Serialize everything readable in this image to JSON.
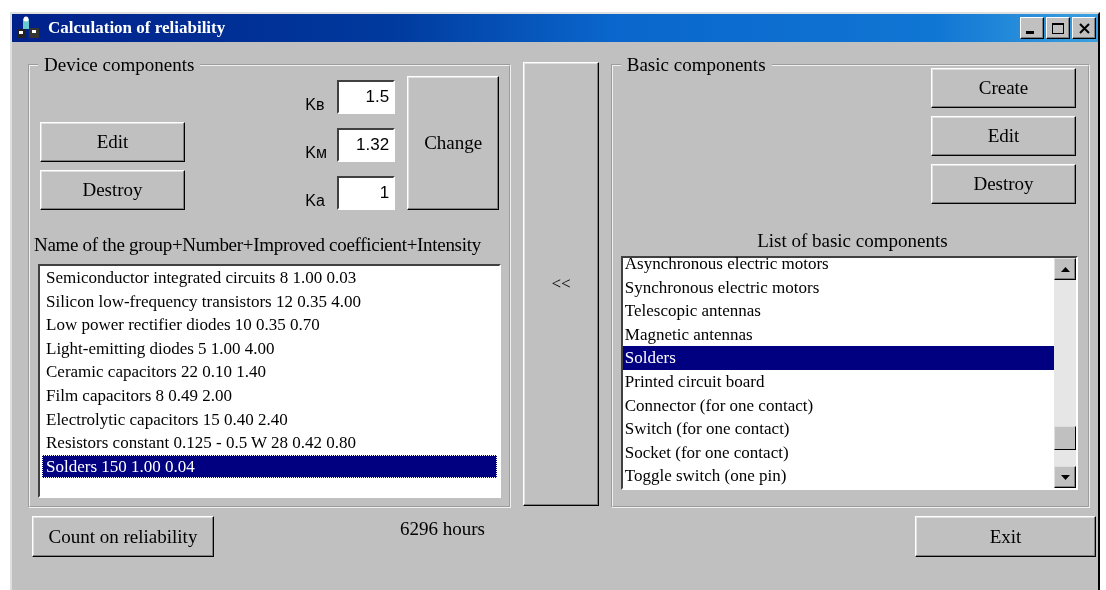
{
  "window": {
    "title": "Calculation of reliability"
  },
  "device_components": {
    "legend": "Device components",
    "buttons": [
      "Edit",
      "Destroy"
    ],
    "coefficients": [
      {
        "label": "Kв",
        "value": "1.5"
      },
      {
        "label": "Kм",
        "value": "1.32"
      },
      {
        "label": "Ka",
        "value": "1"
      }
    ],
    "change_button": "Change",
    "list_caption": "Name of the group+Number+Improved coefficient+Intensity",
    "items": [
      {
        "text": "Semiconductor integrated circuits 8 1.00 0.03",
        "selected": false
      },
      {
        "text": "Silicon low-frequency transistors 12 0.35 4.00",
        "selected": false
      },
      {
        "text": "Low power rectifier diodes 10 0.35 0.70",
        "selected": false
      },
      {
        "text": "Light-emitting diodes 5 1.00 4.00",
        "selected": false
      },
      {
        "text": "Ceramic capacitors 22 0.10 1.40",
        "selected": false
      },
      {
        "text": "Film capacitors 8 0.49 2.00",
        "selected": false
      },
      {
        "text": "Electrolytic capacitors 15 0.40 2.40",
        "selected": false
      },
      {
        "text": "Resistors constant 0.125 - 0.5 W 28 0.42 0.80",
        "selected": false
      },
      {
        "text": "Solders 150 1.00 0.04",
        "selected": true
      }
    ]
  },
  "transfer_button": "<<",
  "basic_components": {
    "legend": "Basic components",
    "buttons": [
      "Create",
      "Edit",
      "Destroy"
    ],
    "list_caption": "List of basic components",
    "items": [
      {
        "text": "Asynchronous electric motors",
        "selected": false
      },
      {
        "text": "Synchronous electric motors",
        "selected": false
      },
      {
        "text": "Telescopic antennas",
        "selected": false
      },
      {
        "text": "Magnetic antennas",
        "selected": false
      },
      {
        "text": "Solders",
        "selected": true
      },
      {
        "text": "Printed circuit board",
        "selected": false
      },
      {
        "text": "Connector (for one contact)",
        "selected": false
      },
      {
        "text": "Switch (for one contact)",
        "selected": false
      },
      {
        "text": "Socket (for one contact)",
        "selected": false
      },
      {
        "text": "Toggle switch (one pin)",
        "selected": false
      }
    ]
  },
  "count_button": "Count on reliability",
  "result": "6296 hours",
  "exit_button": "Exit"
}
